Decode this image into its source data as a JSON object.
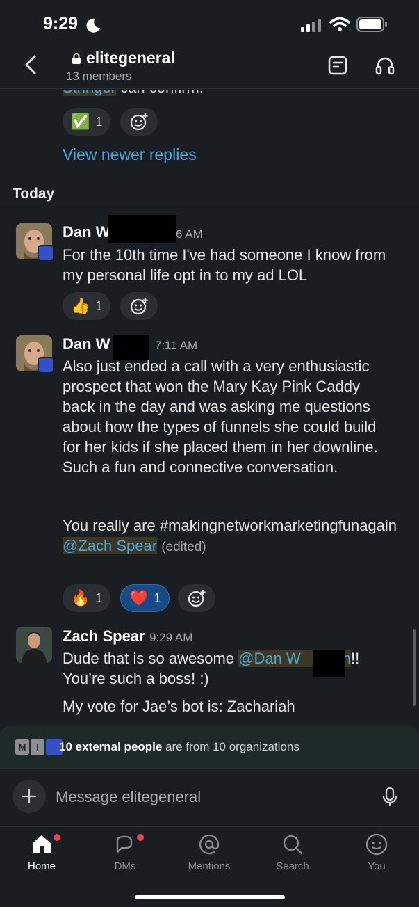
{
  "status_bar": {
    "time": "9:29"
  },
  "header": {
    "channel_name": "elitegeneral",
    "member_count": "13 members"
  },
  "feed": {
    "partial_mention": "Stringer",
    "partial_text": " can confirm!",
    "prev_reaction": {
      "emoji": "✅",
      "count": "1"
    },
    "view_newer": "View newer replies",
    "day_label": "Today",
    "messages": [
      {
        "name": "Dan W",
        "time": "6 AM",
        "text": "For the 10th time I've had someone I know from my personal life opt in to my ad LOL",
        "reactions": [
          {
            "emoji": "👍",
            "count": "1"
          }
        ]
      },
      {
        "name": "Dan W",
        "time": "7:11 AM",
        "text_1": "Also just ended a call with a very enthusiastic prospect that won the Mary Kay Pink Caddy back in the day and was asking me questions about how the types of funnels she could build for her kids if she placed them in her downline. Such a fun and connective conversation.",
        "text_2": "You really are #makingnetworkmarketingfunagain ",
        "mention": "@Zach Spear",
        "edited": "(edited)",
        "reactions": [
          {
            "emoji": "🔥",
            "count": "1"
          },
          {
            "emoji": "❤️",
            "count": "1"
          }
        ]
      },
      {
        "name": "Zach Spear",
        "time": "9:29 AM",
        "text_pre": "Dude that is so awesome ",
        "mention": "@Dan W",
        "mention_tail": "n",
        "text_post": "!!",
        "line_2": "You’re such a boss! :)",
        "line_3": "My vote for Jae’s bot is: Zachariah"
      }
    ]
  },
  "external_banner": {
    "avatar_letters": [
      "M",
      "I"
    ],
    "bold": "10 external people",
    "rest": " are from 10 organizations"
  },
  "composer": {
    "placeholder": "Message elitegeneral"
  },
  "tabs": [
    {
      "label": "Home",
      "icon": "home-icon",
      "badge": true
    },
    {
      "label": "DMs",
      "icon": "dms-icon",
      "badge": true
    },
    {
      "label": "Mentions",
      "icon": "mentions-icon",
      "badge": false
    },
    {
      "label": "Search",
      "icon": "search-icon",
      "badge": false
    },
    {
      "label": "You",
      "icon": "you-icon",
      "badge": false
    }
  ],
  "colors": {
    "background": "#1a1d21",
    "link": "#4aa6dc",
    "mention_bg": "#3a3424",
    "active_reaction": "#184a85",
    "badge": "#e8435a"
  }
}
